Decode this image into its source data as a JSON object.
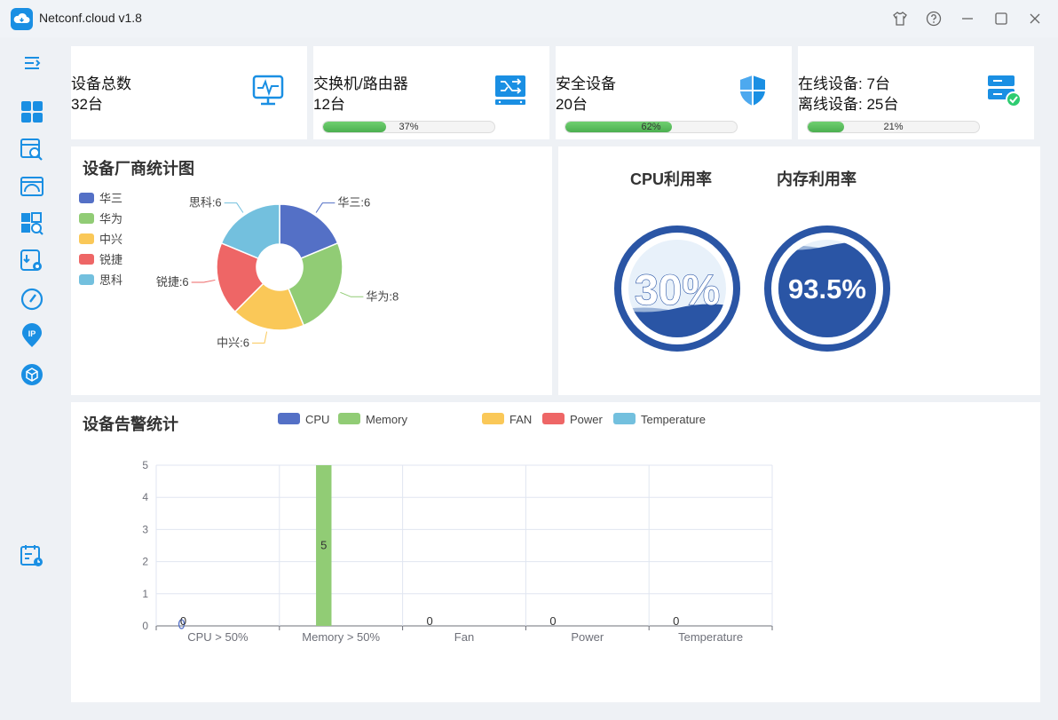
{
  "app": {
    "title": "Netconf.cloud v1.8"
  },
  "stats": [
    {
      "lines": [
        "设备总数",
        "32台"
      ],
      "icon": "monitor-pulse-icon"
    },
    {
      "lines": [
        "交换机/路由器",
        "12台"
      ],
      "icon": "switch-router-icon",
      "progress": 37,
      "progress_label": "37%"
    },
    {
      "lines": [
        "安全设备",
        "20台"
      ],
      "icon": "shield-icon",
      "progress": 62,
      "progress_label": "62%"
    },
    {
      "lines": [
        "在线设备: 7台",
        "离线设备: 25台"
      ],
      "icon": "server-online-icon",
      "progress": 21,
      "progress_label": "21%"
    }
  ],
  "pie": {
    "title": "设备厂商统计图",
    "legend": [
      "华三",
      "华为",
      "中兴",
      "锐捷",
      "思科"
    ],
    "colors": [
      "#5470c6",
      "#91cc75",
      "#fac858",
      "#ee6666",
      "#73c0de"
    ],
    "values": [
      6,
      8,
      6,
      6,
      6
    ],
    "labels": [
      "华三:6",
      "华为:8",
      "中兴:6",
      "锐捷:6",
      "思科:6"
    ]
  },
  "gauges": [
    {
      "title": "CPU利用率",
      "value": 30,
      "label": "30%"
    },
    {
      "title": "内存利用率",
      "value": 93.5,
      "label": "93.5%"
    }
  ],
  "chart_data": {
    "type": "bar",
    "title": "设备告警统计",
    "categories": [
      "CPU > 50%",
      "Memory > 50%",
      "Fan",
      "Power",
      "Temperature"
    ],
    "series": [
      {
        "name": "CPU",
        "values": [
          0,
          0,
          0,
          0,
          0
        ]
      },
      {
        "name": "Memory",
        "values": [
          0,
          5,
          0,
          0,
          0
        ]
      },
      {
        "name": "FAN",
        "values": [
          0,
          0,
          0,
          0,
          0
        ]
      },
      {
        "name": "Power",
        "values": [
          0,
          0,
          0,
          0,
          0
        ]
      },
      {
        "name": "Temperature",
        "values": [
          0,
          0,
          0,
          0,
          0
        ]
      }
    ],
    "colors": [
      "#5470c6",
      "#91cc75",
      "#fac858",
      "#ee6666",
      "#73c0de"
    ],
    "y_ticks": [
      0,
      1,
      2,
      3,
      4,
      5
    ],
    "ylim": [
      0,
      5
    ],
    "grid": true,
    "legend_position": "top",
    "data_labels": [
      {
        "category": 0,
        "series": 0,
        "text": "0"
      },
      {
        "category": 1,
        "series": 1,
        "text": "5"
      },
      {
        "category": 2,
        "series": 0,
        "text": "0"
      },
      {
        "category": 3,
        "series": 0,
        "text": "0"
      },
      {
        "category": 4,
        "series": 0,
        "text": "0"
      }
    ]
  }
}
